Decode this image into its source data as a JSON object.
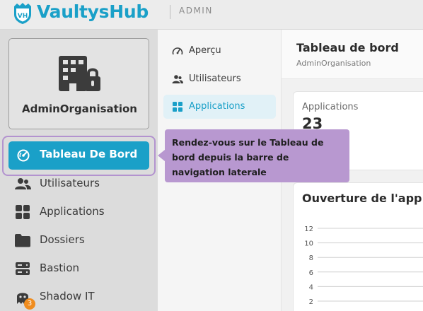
{
  "header": {
    "logo_badge": "VH",
    "brand": "VaultysHub",
    "section": "ADMIN",
    "accent_color": "#1aa0c8"
  },
  "org": {
    "name": "AdminOrganisation",
    "icon": "building-lock-icon"
  },
  "sidebar": {
    "items": [
      {
        "label": "Tableau De Bord",
        "icon": "dashboard-gauge-icon",
        "active": true
      },
      {
        "label": "Utilisateurs",
        "icon": "users-icon"
      },
      {
        "label": "Applications",
        "icon": "apps-grid-icon"
      },
      {
        "label": "Dossiers",
        "icon": "folder-icon"
      },
      {
        "label": "Bastion",
        "icon": "server-icon"
      },
      {
        "label": "Shadow IT",
        "icon": "ghost-icon",
        "badge": "3"
      }
    ]
  },
  "subnav": {
    "items": [
      {
        "label": "Aperçu",
        "icon": "gauge-icon"
      },
      {
        "label": "Utilisateurs",
        "icon": "users-icon"
      },
      {
        "label": "Applications",
        "icon": "apps-grid-icon",
        "active": true
      }
    ]
  },
  "main": {
    "title": "Tableau de bord",
    "subtitle": "AdminOrganisation",
    "stat": {
      "label": "Applications",
      "value": "23"
    },
    "chart_title": "Ouverture de l'app"
  },
  "tooltip": {
    "text": "Rendez-vous sur le Tableau de bord depuis la barre de navigation laterale"
  },
  "chart_data": {
    "type": "line",
    "title": "Ouverture de l'app",
    "yticks": [
      "12",
      "10",
      "8",
      "6",
      "4",
      "2"
    ],
    "ylim": [
      0,
      12
    ],
    "grid": true,
    "series": []
  }
}
